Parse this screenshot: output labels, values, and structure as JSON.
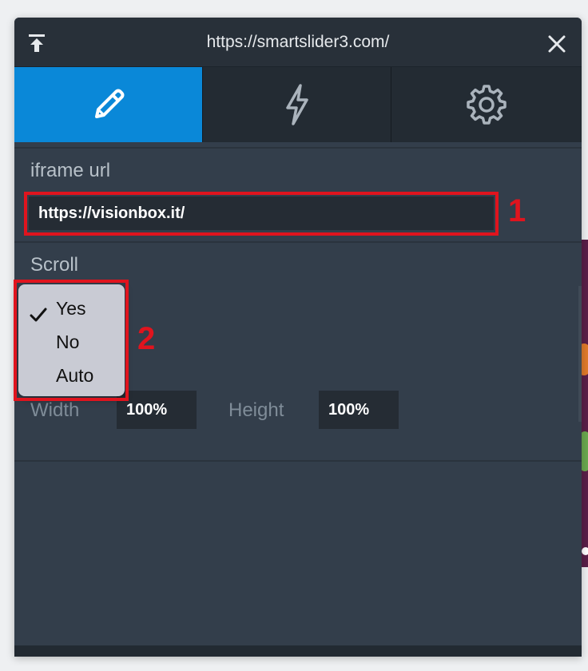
{
  "window": {
    "title": "https://smartslider3.com/"
  },
  "tabs": [
    {
      "icon": "pencil-icon",
      "active": true
    },
    {
      "icon": "lightning-icon",
      "active": false
    },
    {
      "icon": "gear-icon",
      "active": false
    }
  ],
  "iframe": {
    "label": "iframe url",
    "value": "https://visionbox.it/"
  },
  "scroll": {
    "label": "Scroll",
    "options": [
      "Yes",
      "No",
      "Auto"
    ],
    "selected": "Yes"
  },
  "size": {
    "width_label": "Width",
    "width_value": "100%",
    "height_label": "Height",
    "height_value": "100%"
  },
  "annotations": {
    "first": "1",
    "second": "2"
  },
  "colors": {
    "accent": "#0a88d8",
    "panel": "#333e4b",
    "highlight": "#e0141e"
  }
}
